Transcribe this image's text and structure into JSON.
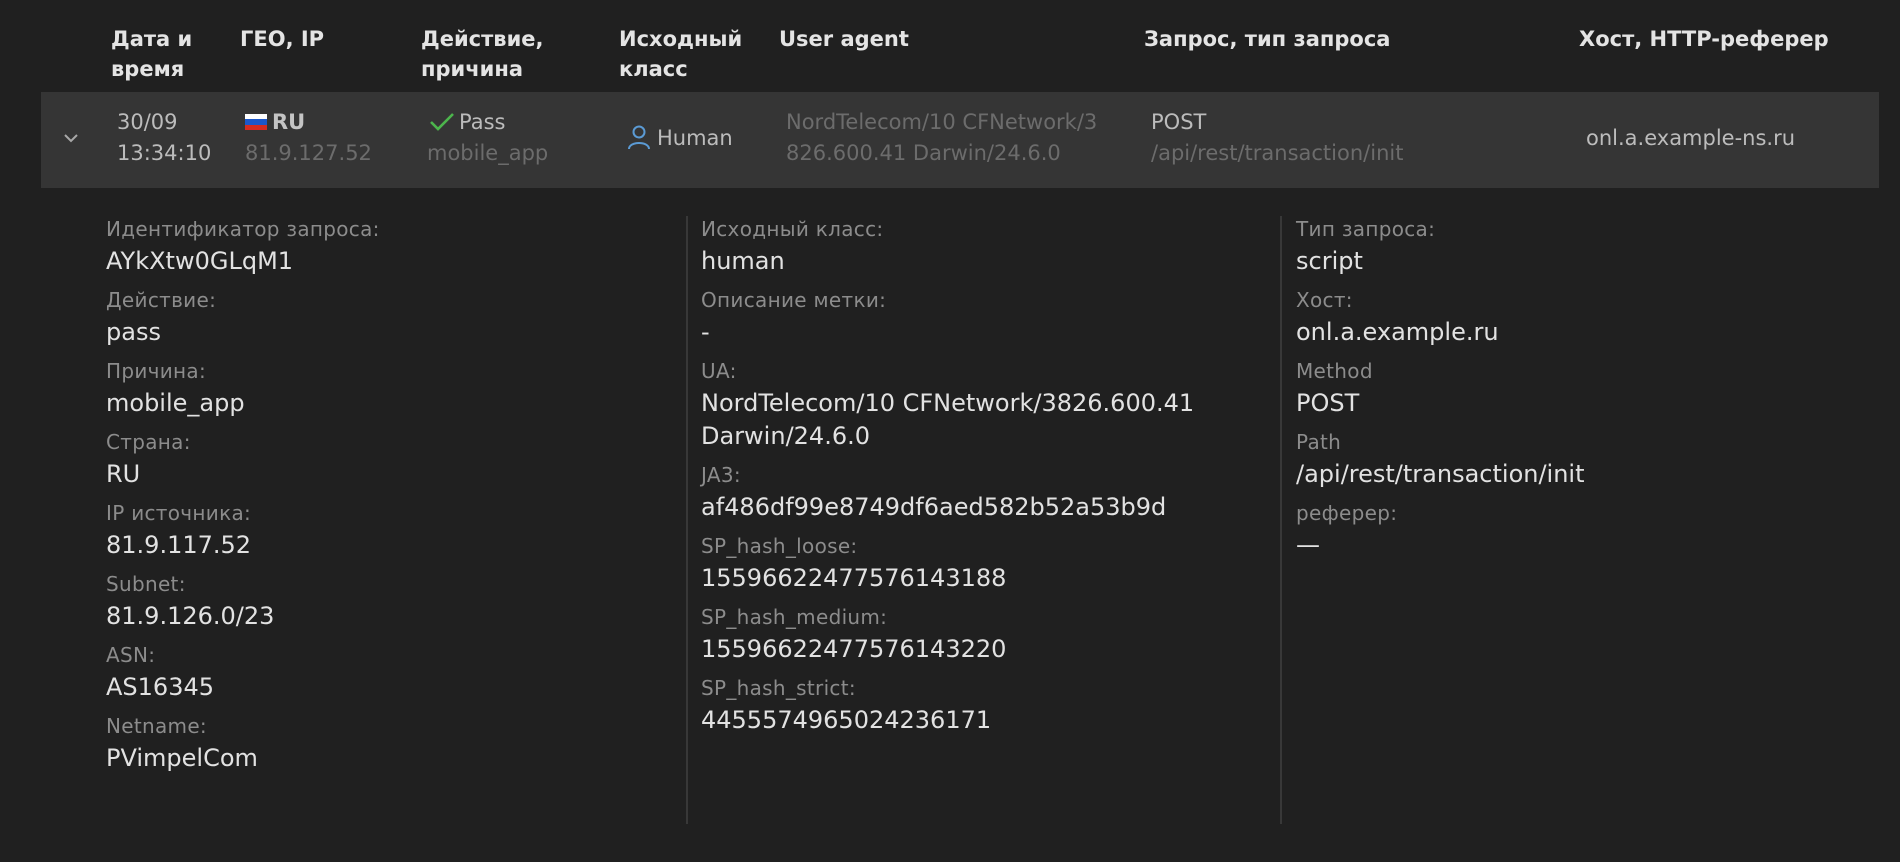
{
  "columns": {
    "datetime": "Дата и\nвремя",
    "geo_ip": "ГЕО, IP",
    "action_reason": "Действие,\nпричина",
    "source_class": "Исходный\nкласс",
    "user_agent": "User agent",
    "request_type": "Запрос, тип запроса",
    "host_referer": "Хост, HTTP-реферер"
  },
  "row": {
    "date": "30/09",
    "time": "13:34:10",
    "country": "RU",
    "ip": "81.9.127.52",
    "action": "Pass",
    "reason": "mobile_app",
    "class": "Human",
    "user_agent": "NordTelecom/10 CFNetwork/3\n826.600.41 Darwin/24.6.0",
    "method": "POST",
    "path": "/api/rest/transaction/init",
    "host": "onl.a.example-ns.ru"
  },
  "details": {
    "col1": [
      {
        "label": "Идентификатор запроса:",
        "value": "AYkXtw0GLqM1"
      },
      {
        "label": "Действие:",
        "value": "pass"
      },
      {
        "label": "Причина:",
        "value": "mobile_app"
      },
      {
        "label": "Страна:",
        "value": "RU"
      },
      {
        "label": "IP источника:",
        "value": "81.9.117.52"
      },
      {
        "label": "Subnet:",
        "value": "81.9.126.0/23"
      },
      {
        "label": "ASN:",
        "value": "AS16345"
      },
      {
        "label": "Netname:",
        "value": "PVimpelCom"
      }
    ],
    "col2": [
      {
        "label": "Исходный класс:",
        "value": "human"
      },
      {
        "label": "Описание метки:",
        "value": "-"
      },
      {
        "label": "UA:",
        "value": "NordTelecom/10 CFNetwork/3826.600.41\nDarwin/24.6.0"
      },
      {
        "label": "JA3:",
        "value": "af486df99e8749df6aed582b52a53b9d"
      },
      {
        "label": "SP_hash_loose:",
        "value": "15596622477576143188"
      },
      {
        "label": "SP_hash_medium:",
        "value": "15596622477576143220"
      },
      {
        "label": "SP_hash_strict:",
        "value": "4455574965024236171"
      }
    ],
    "col3": [
      {
        "label": "Тип запроса:",
        "value": "script"
      },
      {
        "label": "Хост:",
        "value": "onl.a.example.ru"
      },
      {
        "label": "Method",
        "value": "POST"
      },
      {
        "label": "Path",
        "value": "/api/rest/transaction/init"
      },
      {
        "label": "реферер:",
        "value": "—"
      }
    ]
  },
  "colors": {
    "pass": "#4cb54c",
    "human_icon": "#5b9bd5",
    "flag": [
      "#ffffff",
      "#1c57c8",
      "#d52b1e"
    ]
  },
  "icons": {
    "expand": "chevron-down-icon",
    "action": "check-icon",
    "class": "user-icon"
  }
}
